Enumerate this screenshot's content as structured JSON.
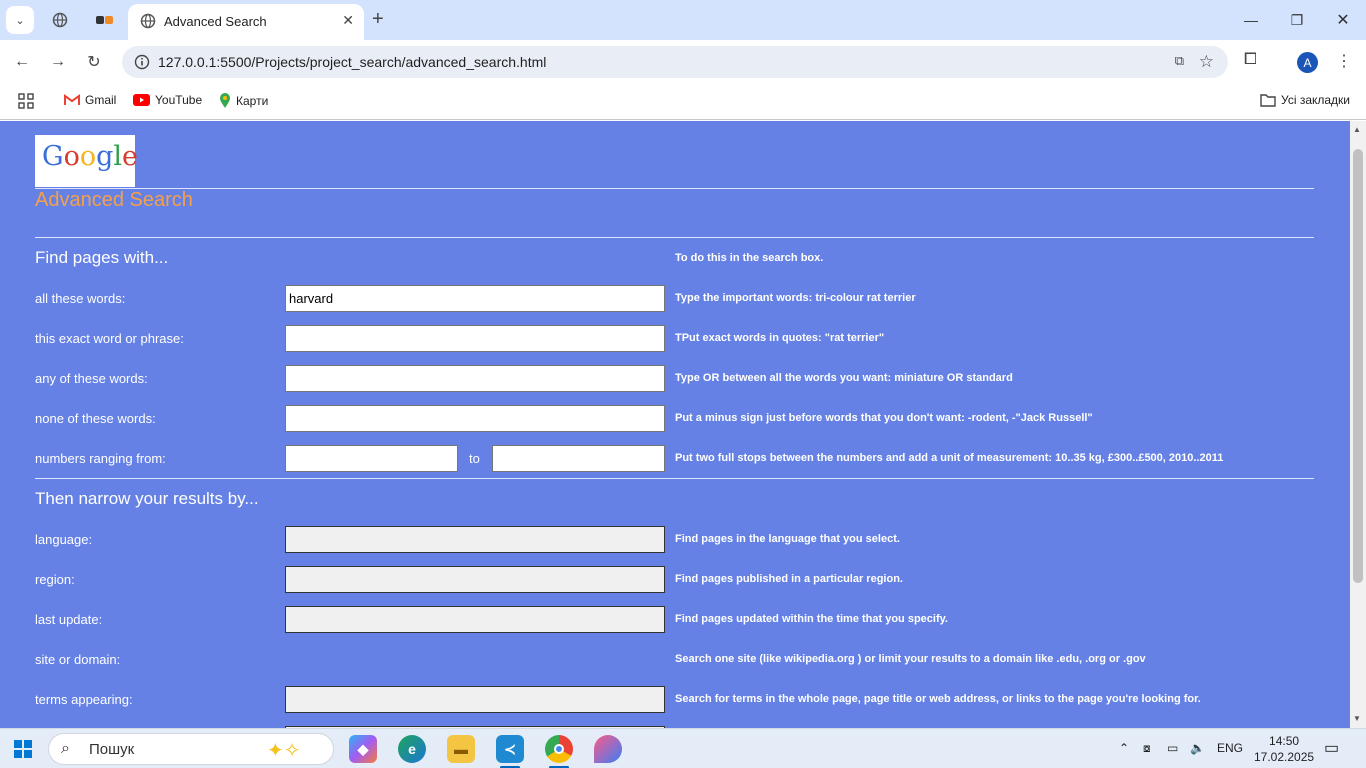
{
  "browser": {
    "active_tab_title": "Advanced Search",
    "url": "127.0.0.1:5500/Projects/project_search/advanced_search.html",
    "bookmarks": [
      "Gmail",
      "YouTube",
      "Карти"
    ],
    "all_bookmarks_label": "Усі закладки",
    "profile_initial": "A"
  },
  "page": {
    "logo_text": "Google",
    "title": "Advanced Search",
    "find_section": {
      "heading": "Find pages with...",
      "hint": "To do this in the search box.",
      "rows": [
        {
          "label": "all these words:",
          "value": "harvard",
          "hint": "Type the important words: tri-colour rat terrier"
        },
        {
          "label": "this exact word or phrase:",
          "value": "",
          "hint": "TPut exact words in quotes: \"rat terrier\""
        },
        {
          "label": "any of these words:",
          "value": "",
          "hint": "Type OR between all the words you want: miniature OR standard"
        },
        {
          "label": "none of these words:",
          "value": "",
          "hint": "Put a minus sign just before words that you don't want: -rodent, -\"Jack Russell\""
        }
      ],
      "numbers": {
        "label": "numbers ranging from:",
        "to_label": "to",
        "from_value": "",
        "to_value": "",
        "hint": "Put two full stops between the numbers and add a unit of measurement: 10..35 kg, £300..£500, 2010..2011"
      }
    },
    "narrow_section": {
      "heading": "Then narrow your results by...",
      "rows": [
        {
          "label": "language:",
          "hint": "Find pages in the language that you select."
        },
        {
          "label": "region:",
          "hint": "Find pages published in a particular region."
        },
        {
          "label": "last update:",
          "hint": "Find pages updated within the time that you specify."
        },
        {
          "label": "site or domain:",
          "hint": "Search one site (like wikipedia.org ) or limit your results to a domain like .edu, .org or .gov"
        },
        {
          "label": "terms appearing:",
          "hint": "Search for terms in the whole page, page title or web address, or links to the page you're looking for."
        }
      ]
    }
  },
  "taskbar": {
    "search_placeholder": "Пошук",
    "language": "ENG",
    "time": "14:50",
    "date": "17.02.2025"
  },
  "colors": {
    "page_bg": "#6581e5",
    "title_orange": "#f4a04b"
  }
}
